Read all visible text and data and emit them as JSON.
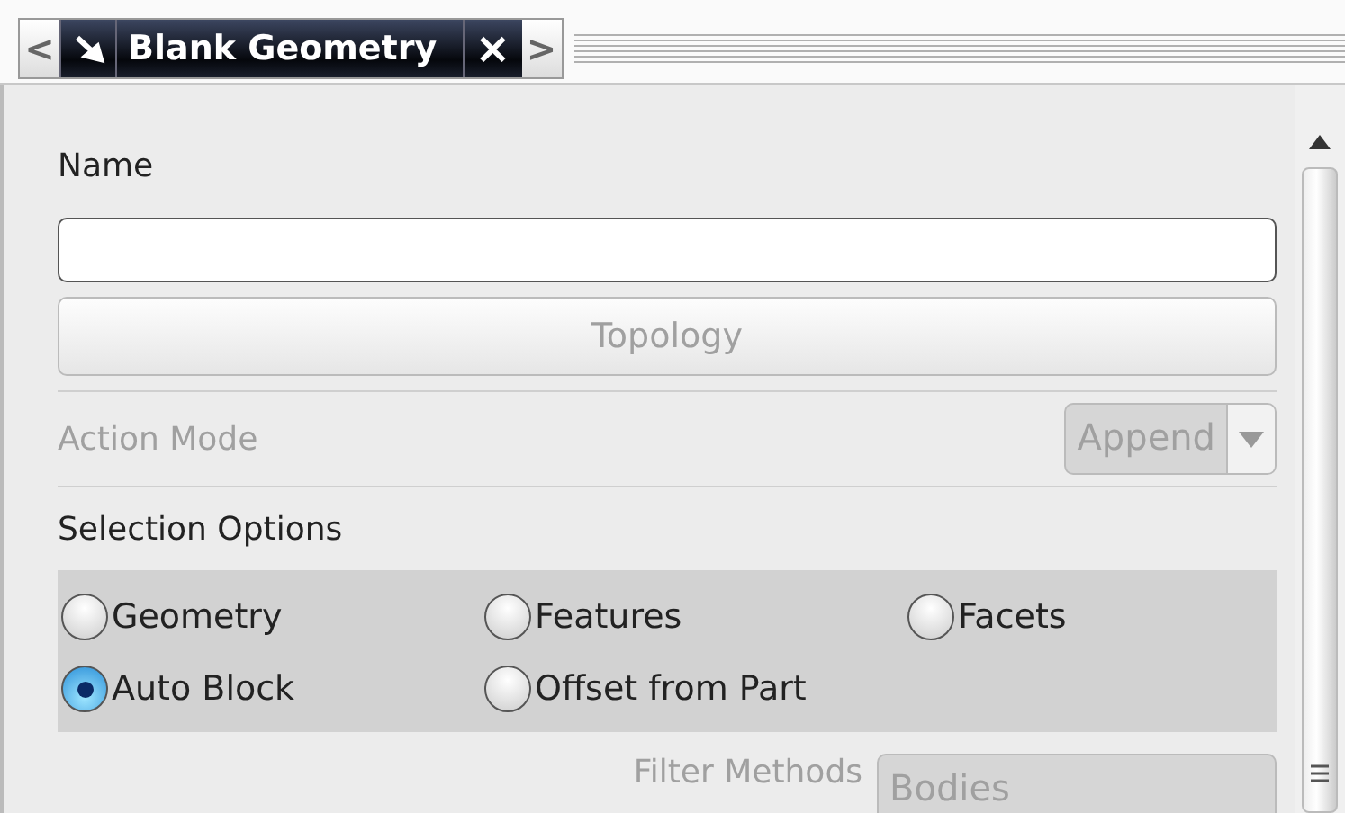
{
  "tab_bar": {
    "prev": "<",
    "title": "Blank Geometry",
    "close": "×",
    "next": ">"
  },
  "name_field": {
    "label": "Name"
  },
  "topology_button": {
    "label": "Topology",
    "disabled": true
  },
  "action_mode": {
    "label": "Action Mode",
    "value": "Append",
    "disabled": true
  },
  "selection_options": {
    "label": "Selection Options",
    "options": [
      {
        "label": "Geometry",
        "selected": false
      },
      {
        "label": "Features",
        "selected": false
      },
      {
        "label": "Facets",
        "selected": false
      },
      {
        "label": "Auto Block",
        "selected": true
      },
      {
        "label": "Offset from Part",
        "selected": false
      }
    ]
  },
  "filter_methods": {
    "label": "Filter Methods",
    "value": "Bodies",
    "disabled": true
  }
}
